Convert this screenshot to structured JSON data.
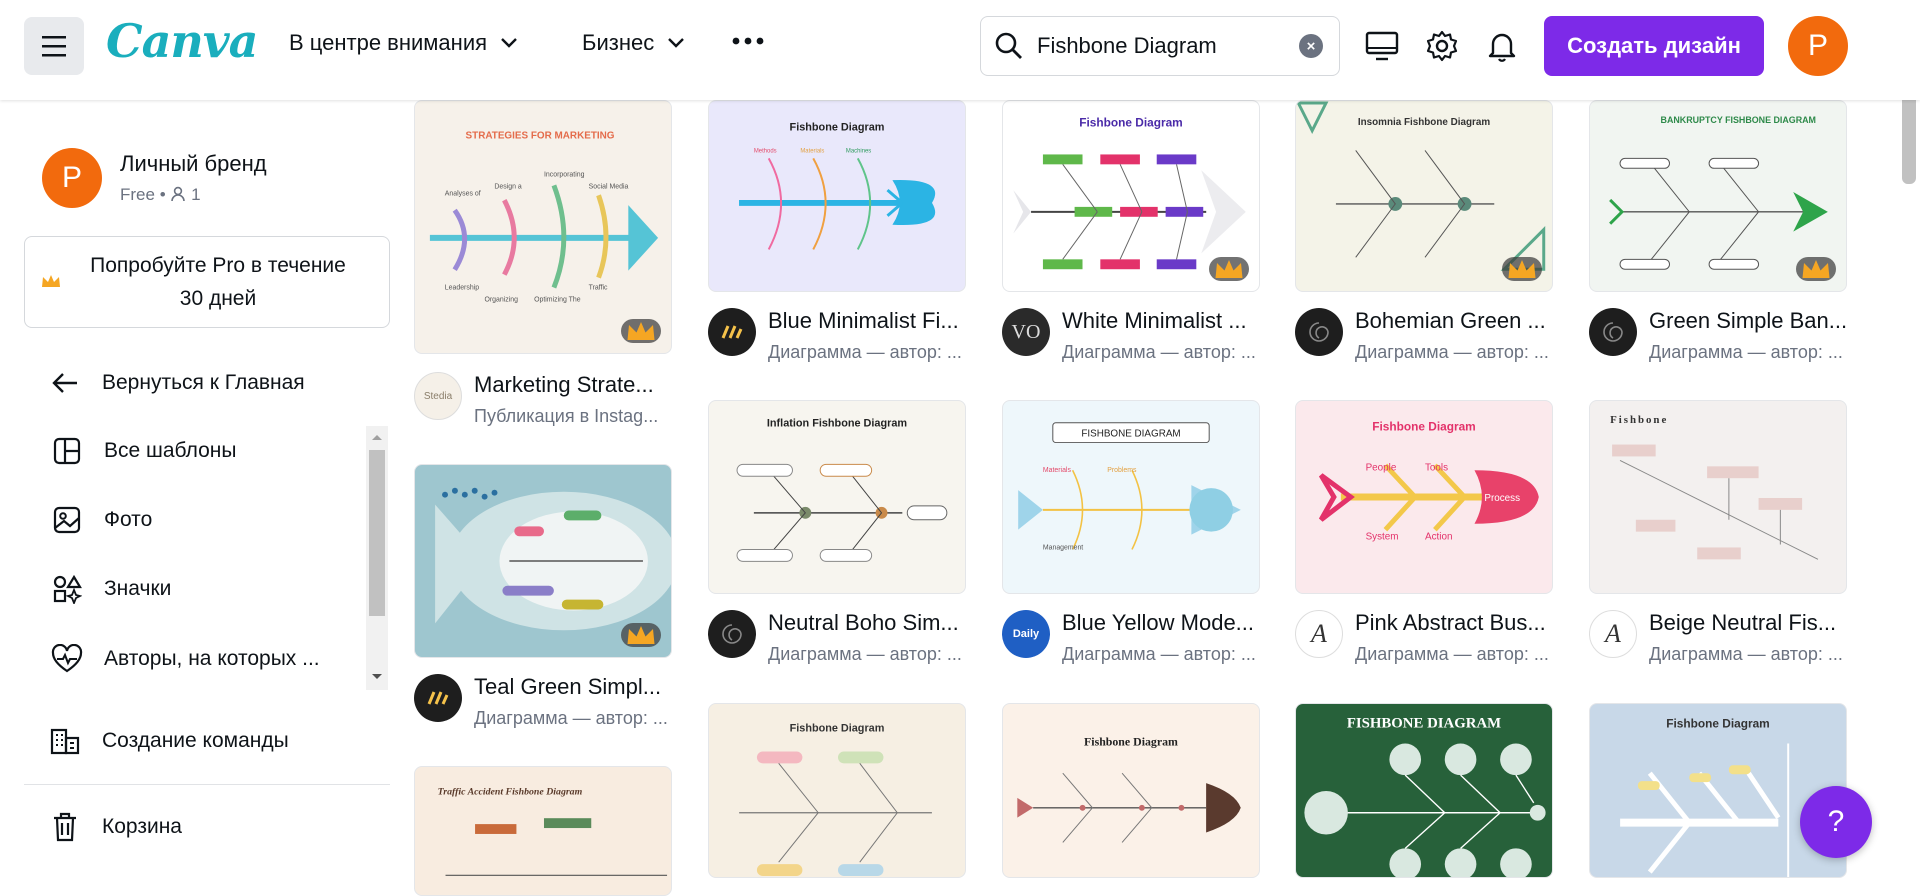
{
  "header": {
    "logo": "Canva",
    "nav": [
      "В центре внимания",
      "Бизнес"
    ],
    "search_value": "Fishbone Diagram",
    "create_label": "Создать дизайн",
    "avatar_letter": "P"
  },
  "sidebar": {
    "profile_name": "Личный бренд",
    "profile_plan": "Free",
    "profile_members": "1",
    "avatar_letter": "P",
    "pro_line1": "Попробуйте Pro в течение",
    "pro_line2": "30 дней",
    "back_label": "Вернуться к Главная",
    "items": [
      "Все шаблоны",
      "Фото",
      "Значки",
      "Авторы, на которых ..."
    ],
    "team_label": "Создание команды",
    "trash_label": "Корзина"
  },
  "thumbs": {
    "t1_title": "STRATEGIES FOR MARKETING",
    "t2_title": "Fishbone Diagram",
    "t3_title": "Fishbone Diagram",
    "t4_title": "Insomnia Fishbone Diagram",
    "t5_title": "BANKRUPTCY FISHBONE DIAGRAM",
    "t6_title": "Inflation Fishbone Diagram",
    "t7_title": "FISHBONE DIAGRAM",
    "t8_title": "Fishbone Diagram",
    "t9_title": "Fishbone",
    "t10_title": "Fishbone Diagram",
    "t11_title": "Fishbone Diagram",
    "t12_title": "FISHBONE DIAGRAM",
    "t13_title": "Fishbone Diagram",
    "t14_title": "Traffic Accident Fishbone Diagram"
  },
  "cards": [
    {
      "title": "Marketing Strate...",
      "sub": "Публикация в Instag..."
    },
    {
      "title": "Teal Green Simpl...",
      "sub": "Диаграмма — автор: ..."
    },
    {
      "title": "Blue Minimalist Fi...",
      "sub": "Диаграмма — автор: ..."
    },
    {
      "title": "Neutral Boho Sim...",
      "sub": "Диаграмма — автор: ..."
    },
    {
      "title": "White Minimalist ...",
      "sub": "Диаграмма — автор: ..."
    },
    {
      "title": "Blue Yellow Mode...",
      "sub": "Диаграмма — автор: ..."
    },
    {
      "title": "Bohemian Green ...",
      "sub": "Диаграмма — автор: ..."
    },
    {
      "title": "Pink Abstract Bus...",
      "sub": "Диаграмма — автор: ..."
    },
    {
      "title": "Green Simple Ban...",
      "sub": "Диаграмма — автор: ..."
    },
    {
      "title": "Beige Neutral Fis...",
      "sub": "Диаграмма — автор: ..."
    }
  ],
  "help_label": "?"
}
